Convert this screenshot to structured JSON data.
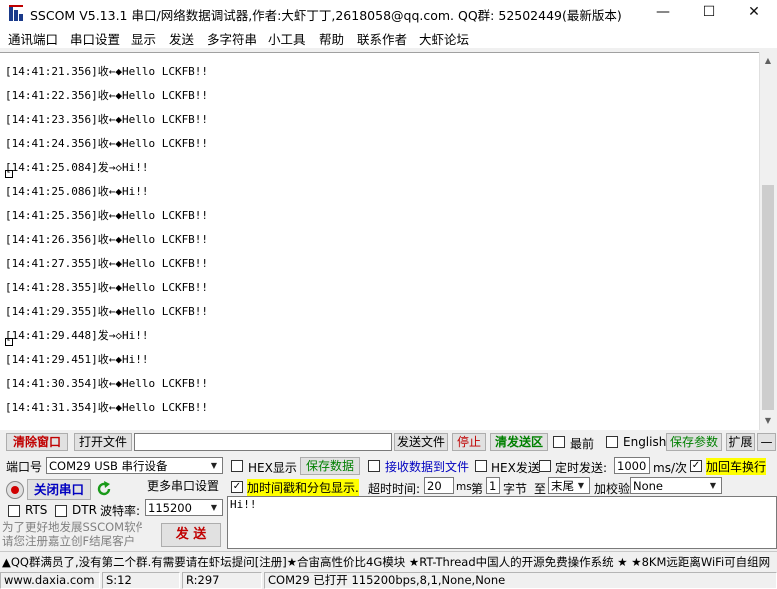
{
  "window": {
    "title": "SSCOM V5.13.1 串口/网络数据调试器,作者:大虾丁丁,2618058@qq.com. QQ群: 52502449(最新版本)"
  },
  "menu": [
    "通讯端口",
    "串口设置",
    "显示",
    "发送",
    "多字符串",
    "小工具",
    "帮助",
    "联系作者",
    "大虾论坛"
  ],
  "log": [
    {
      "text": "[14:41:21.356]收←◆Hello LCKFB!!"
    },
    {
      "text": "[14:41:22.356]收←◆Hello LCKFB!!"
    },
    {
      "text": "[14:41:23.356]收←◆Hello LCKFB!!"
    },
    {
      "text": "[14:41:24.356]收←◆Hello LCKFB!!"
    },
    {
      "text": "[14:41:25.084]发→◇Hi!!",
      "box": true
    },
    {
      "text": "[14:41:25.086]收←◆Hi!!"
    },
    {
      "text": "[14:41:25.356]收←◆Hello LCKFB!!"
    },
    {
      "text": "[14:41:26.356]收←◆Hello LCKFB!!"
    },
    {
      "text": "[14:41:27.355]收←◆Hello LCKFB!!"
    },
    {
      "text": "[14:41:28.355]收←◆Hello LCKFB!!"
    },
    {
      "text": "[14:41:29.355]收←◆Hello LCKFB!!"
    },
    {
      "text": "[14:41:29.448]发→◇Hi!!",
      "box": true
    },
    {
      "text": "[14:41:29.451]收←◆Hi!!"
    },
    {
      "text": "[14:41:30.354]收←◆Hello LCKFB!!"
    },
    {
      "text": "[14:41:31.354]收←◆Hello LCKFB!!"
    }
  ],
  "toolbar": {
    "clear_window": "清除窗口",
    "open_file": "打开文件",
    "file_path": "",
    "send_file": "发送文件",
    "stop": "停止",
    "clear_send": "清发送区",
    "topmost": "最前",
    "english": "English",
    "save_params": "保存参数",
    "expand": "扩展",
    "collapse": "—"
  },
  "port": {
    "port_label": "端口号",
    "port_value": "COM29 USB 串行设备",
    "close_port": "关闭串口",
    "more_settings": "更多串口设置",
    "rts": "RTS",
    "dtr": "DTR",
    "baud_label": "波特率:",
    "baud_value": "115200"
  },
  "options": {
    "hex_display": "HEX显示",
    "save_data": "保存数据",
    "recv_to_file": "接收数据到文件",
    "hex_send": "HEX发送",
    "timed_send": "定时发送:",
    "timed_value": "1000",
    "timed_unit": "ms/次",
    "add_crlf": "加回车换行",
    "add_timestamp": "加时间戳和分包显示.",
    "timeout_label": "超时时间:",
    "timeout_value": "20",
    "timeout_unit": "ms",
    "byte_prefix": "第",
    "byte_index": "1",
    "byte_label": "字节",
    "to_label": "至",
    "end_value": "末尾",
    "checksum_label": "加校验",
    "checksum_value": "None"
  },
  "send": {
    "text": "Hi!!",
    "button": "发 送",
    "promo_line1": "为了更好地发展SSCOM软件",
    "promo_line2": "请您注册嘉立创F结尾客户"
  },
  "ticker": "▲QQ群满员了,没有第二个群.有需要请在虾坛提问[注册]★合宙高性价比4G模块 ★RT-Thread中国人的开源免费操作系统 ★ ★8KM远距离WiFi可自组网",
  "status": {
    "website": "www.daxia.com",
    "sent": "S:12",
    "received": "R:297",
    "port_state": "COM29 已打开  115200bps,8,1,None,None"
  }
}
